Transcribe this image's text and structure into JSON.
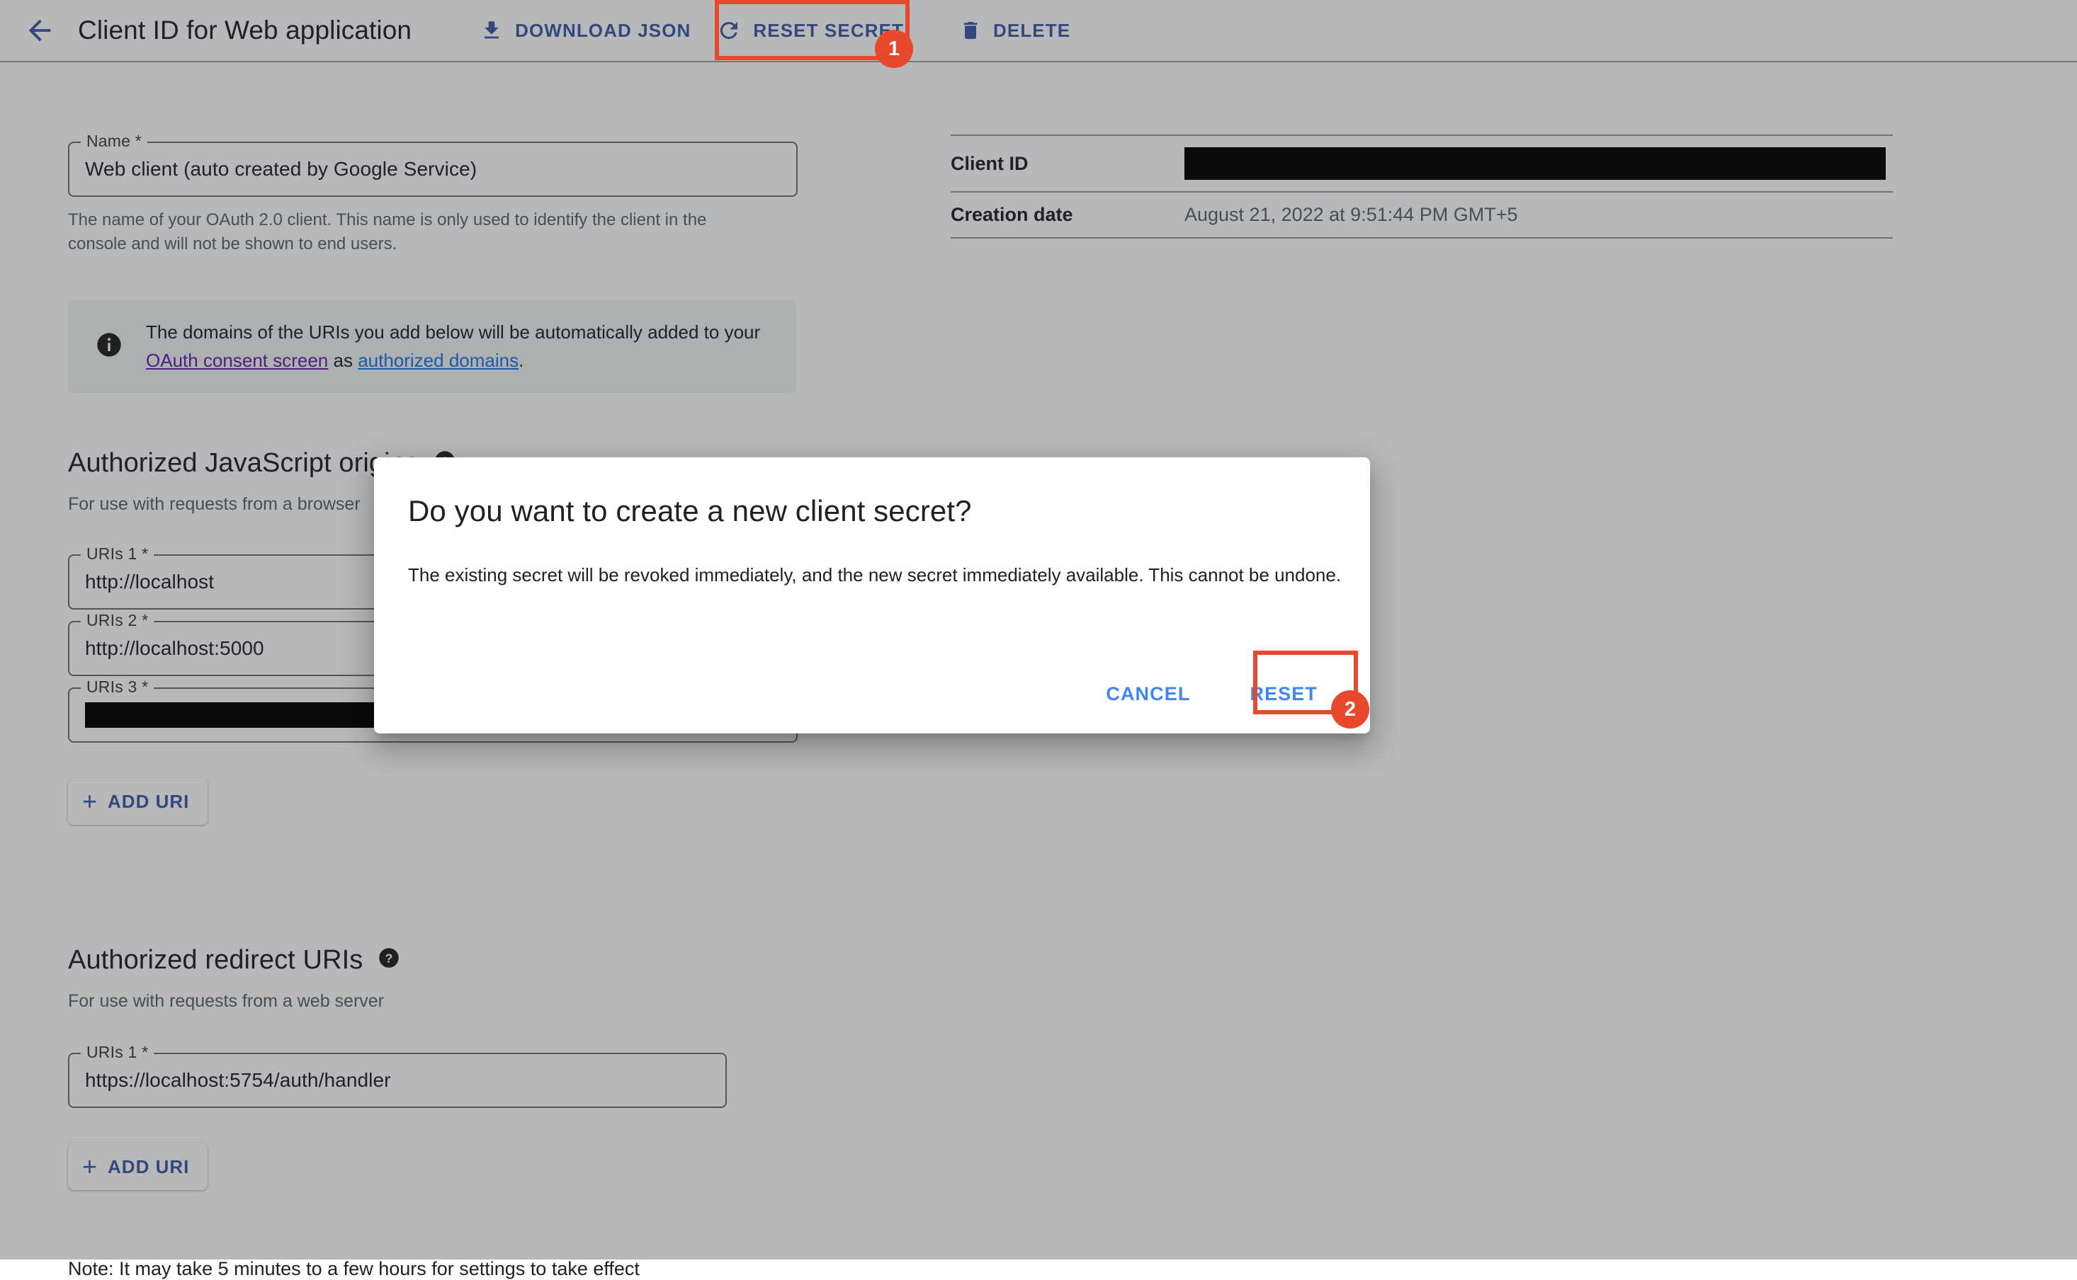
{
  "header": {
    "back_icon": "arrow-left-icon",
    "title": "Client ID for Web application",
    "actions": [
      {
        "label": "DOWNLOAD JSON",
        "icon": "download-icon"
      },
      {
        "label": "RESET SECRET",
        "icon": "refresh-icon"
      },
      {
        "label": "DELETE",
        "icon": "trash-icon"
      }
    ]
  },
  "name_field": {
    "label": "Name *",
    "value": "Web client  (auto created by Google Service)",
    "helper": "The name of your OAuth 2.0 client. This name is only used to identify the client in the console and will not be shown to end users."
  },
  "callout": {
    "icon": "info-icon",
    "text_before": "The domains of the URIs you add below will be automatically added to your ",
    "link1": "OAuth consent screen",
    "text_mid": " as ",
    "link2": "authorized domains",
    "text_after": "."
  },
  "js_origins": {
    "title": "Authorized JavaScript origins",
    "help_icon": "help-icon",
    "subtitle": "For use with requests from a browser",
    "uris": [
      {
        "label": "URIs 1 *",
        "value": "http://localhost",
        "redacted": false
      },
      {
        "label": "URIs 2 *",
        "value": "http://localhost:5000",
        "redacted": false
      },
      {
        "label": "URIs 3 *",
        "value": "",
        "redacted": true
      }
    ],
    "add_button": "ADD URI",
    "add_icon": "plus-icon"
  },
  "redirect_uris": {
    "title": "Authorized redirect URIs",
    "help_icon": "help-icon",
    "subtitle": "For use with requests from a web server",
    "uris": [
      {
        "label": "URIs 1 *",
        "value": "https://localhost:5754/auth/handler",
        "redacted": false
      }
    ],
    "add_button": "ADD URI",
    "add_icon": "plus-icon"
  },
  "note": "Note: It may take 5 minutes to a few hours for settings to take effect",
  "summary": {
    "rows": [
      {
        "key": "Client ID",
        "value": "",
        "redacted": true
      },
      {
        "key": "Creation date",
        "value": "August 21, 2022 at 9:51:44 PM GMT+5",
        "redacted": false
      }
    ]
  },
  "dialog": {
    "title": "Do you want to create a new client secret?",
    "body": "The existing secret will be revoked immediately, and the new secret immediately available. This cannot be undone.",
    "cancel_label": "CANCEL",
    "reset_label": "RESET"
  },
  "annotations": {
    "accent_color": "#e8482b",
    "steps": [
      {
        "number": "1",
        "target": "reset-secret-button"
      },
      {
        "number": "2",
        "target": "dialog-reset-button"
      }
    ]
  },
  "colors": {
    "link_blue": "#1a73e8",
    "link_visited_purple": "#681da8",
    "action_blue": "#3c5aa8",
    "dialog_button_blue": "#4285f4",
    "scrim": "rgba(32,33,36,0.32)"
  }
}
